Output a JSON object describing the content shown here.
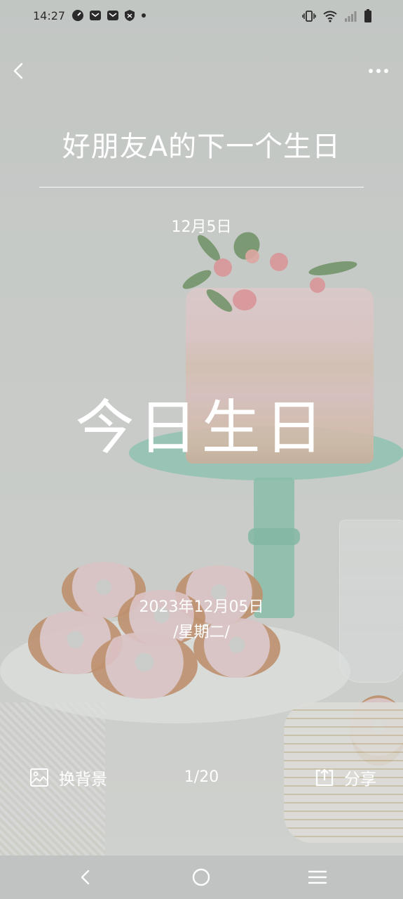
{
  "status_bar": {
    "time": "14:27",
    "left_icons": [
      "speed-icon",
      "mail-icon",
      "mail-icon",
      "shield-icon",
      "dot-icon"
    ],
    "right_icons": [
      "vibrate-icon",
      "wifi-icon",
      "signal-icon",
      "battery-icon"
    ]
  },
  "header": {
    "back_icon": "chevron-left-icon",
    "more_icon": "more-dots-icon"
  },
  "card": {
    "title": "好朋友A的下一个生日",
    "date_short": "12月5日",
    "status": "今日生日",
    "full_date": "2023年12月05日",
    "weekday": "/星期二/"
  },
  "bottom": {
    "change_background_label": "换背景",
    "change_background_icon": "image-icon",
    "page_counter": "1/20",
    "share_label": "分享",
    "share_icon": "share-icon"
  },
  "nav": {
    "back_icon": "nav-back-icon",
    "home_icon": "nav-home-icon",
    "menu_icon": "nav-menu-icon",
    "bar_color": "#c1c3c3"
  }
}
